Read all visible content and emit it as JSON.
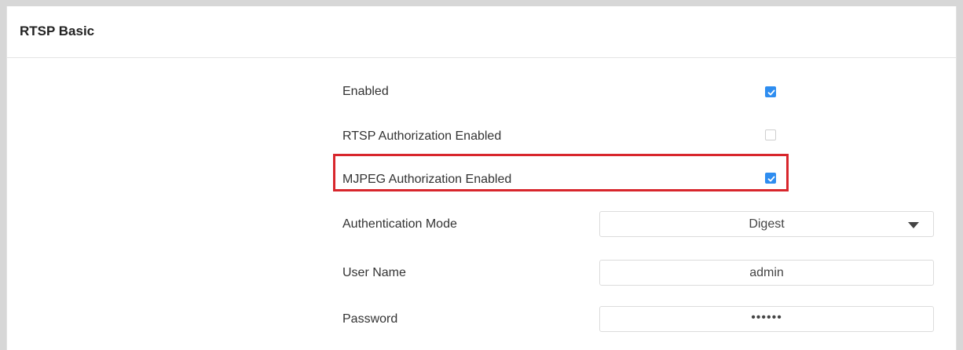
{
  "section": {
    "title": "RTSP Basic"
  },
  "rows": {
    "enabled": {
      "label": "Enabled",
      "checked": true
    },
    "rtsp_auth": {
      "label": "RTSP Authorization Enabled",
      "checked": false
    },
    "mjpeg_auth": {
      "label": "MJPEG Authorization Enabled",
      "checked": true
    },
    "auth_mode": {
      "label": "Authentication Mode",
      "value": "Digest"
    },
    "user_name": {
      "label": "User Name",
      "value": "admin"
    },
    "password": {
      "label": "Password",
      "value": "••••••"
    }
  },
  "colors": {
    "accent": "#2e8df0",
    "highlight": "#d8262c"
  },
  "icons": {
    "checkbox_checked": "check-icon",
    "dropdown": "chevron-down-icon"
  }
}
